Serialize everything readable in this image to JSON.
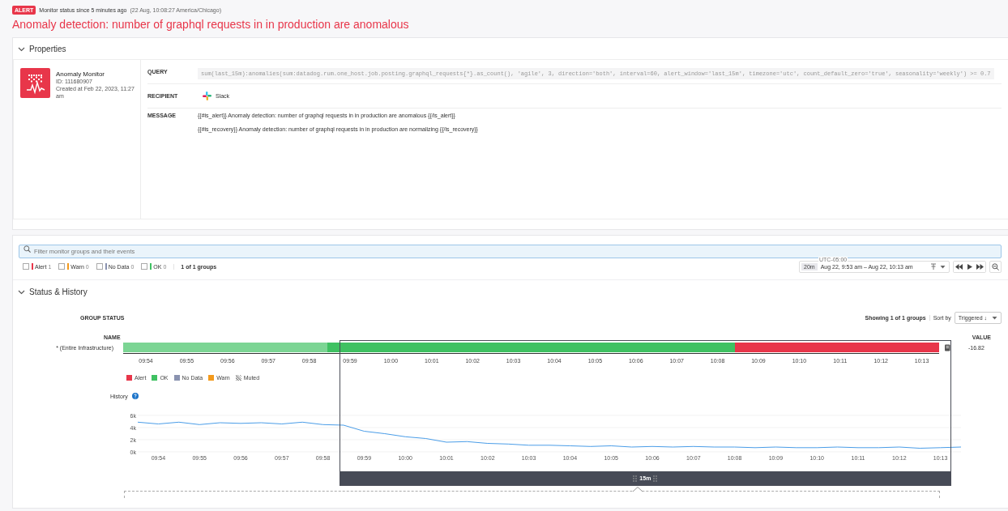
{
  "header": {
    "badge": "ALERT",
    "status_text": "Monitor status since 5 minutes ago",
    "status_time": "(22 Aug, 10:08:27 America/Chicago)",
    "title": "Anomaly detection: number of graphql requests in in production are anomalous"
  },
  "properties": {
    "title": "Properties",
    "expanded": true,
    "monitor": {
      "name": "Anomaly Monitor",
      "id": "ID: 111680907",
      "created": "Created at Feb 22, 2023, 11:27 am"
    },
    "rows": [
      {
        "label": "QUERY",
        "kind": "code",
        "value": "sum(last_15m):anomalies(sum:datadog.rum.one_host.job.posting.graphql_requests{*}.as_count(), 'agile', 3, direction='both', interval=60, alert_window='last_15m', timezone='utc', count_default_zero='true', seasonality='weekly') >= 0.7"
      },
      {
        "label": "RECIPIENT",
        "kind": "recipient",
        "value": "Slack"
      },
      {
        "label": "MESSAGE",
        "kind": "lines",
        "lines": [
          "{{#is_alert}} Anomaly detection: number of graphql requests in in production are anomalous {{/is_alert}}",
          "{{#is_recovery}} Anomaly detection: number of graphql requests in in production are normalizing {{/is_recovery}}"
        ]
      }
    ]
  },
  "filter": {
    "placeholder": "Filter monitor groups and their events",
    "statuses": [
      {
        "label": "Alert",
        "count": "1",
        "color": "#e8364a",
        "checked": false
      },
      {
        "label": "Warn",
        "count": "0",
        "color": "#f39a1c",
        "checked": false
      },
      {
        "label": "No Data",
        "count": "0",
        "color": "#8a93b0",
        "checked": false
      },
      {
        "label": "OK",
        "count": "0",
        "color": "#3fc162",
        "checked": false
      }
    ],
    "groups_count": "1 of 1 groups"
  },
  "time_controls": {
    "span": "20m",
    "timezone": "UTC-05:00",
    "range": "Aug 22, 9:53 am – Aug 22, 10:13 am"
  },
  "status_history": {
    "title": "Status & History",
    "expanded": true,
    "group_status_label": "GROUP STATUS",
    "showing": "Showing 1 of 1 groups",
    "sort_label": "Sort by",
    "sort_value": "Triggered ↓",
    "name_header": "NAME",
    "value_header": "VALUE",
    "groups": [
      {
        "name": "* (Entire Infrastructure)",
        "value": "-16.82",
        "segments": [
          {
            "color": "#3fc162",
            "level": 0.75
          },
          {
            "color": "#e8364a",
            "level": 0.25
          }
        ]
      }
    ],
    "timeline_ticks": [
      "09:54",
      "09:55",
      "09:56",
      "09:57",
      "09:58",
      "09:59",
      "10:00",
      "10:01",
      "10:02",
      "10:03",
      "10:04",
      "10:05",
      "10:06",
      "10:07",
      "10:08",
      "10:09",
      "10:10",
      "10:11",
      "10:12",
      "10:13"
    ],
    "legend": [
      {
        "label": "Alert",
        "kind": "swatch",
        "color": "#e8364a"
      },
      {
        "label": "OK",
        "kind": "swatch",
        "color": "#3fc162"
      },
      {
        "label": "No Data",
        "kind": "swatch",
        "color": "#8a93b0"
      },
      {
        "label": "Warn",
        "kind": "swatch",
        "color": "#f39a1c"
      },
      {
        "label": "Muted",
        "kind": "hatch"
      }
    ],
    "history_label": "History",
    "selection": {
      "label": "15m"
    },
    "chart_data": {
      "type": "line",
      "ylim": [
        0,
        6000
      ],
      "yticks": [
        {
          "value": 0,
          "label": "0k"
        },
        {
          "value": 2000,
          "label": "2k"
        },
        {
          "value": 4000,
          "label": "4k"
        },
        {
          "value": 6000,
          "label": "6k"
        }
      ],
      "categories": [
        null,
        "09:54",
        null,
        "09:55",
        null,
        "09:56",
        null,
        "09:57",
        null,
        "09:58",
        null,
        "09:59",
        null,
        "10:00",
        null,
        "10:01",
        null,
        "10:02",
        null,
        "10:03",
        null,
        "10:04",
        null,
        "10:05",
        null,
        "10:06",
        null,
        "10:07",
        null,
        "10:08",
        null,
        "10:09",
        null,
        "10:10",
        null,
        "10:11",
        null,
        "10:12",
        null,
        "10:13",
        null
      ],
      "series": [
        {
          "color": "#4a9de8",
          "values": [
            4900,
            4600,
            4900,
            4500,
            4800,
            4700,
            4800,
            4600,
            4900,
            4500,
            4400,
            3400,
            3000,
            2500,
            2200,
            1600,
            1700,
            1400,
            1300,
            1100,
            1100,
            1000,
            900,
            1000,
            800,
            900,
            800,
            900,
            800,
            800,
            700,
            800,
            700,
            700,
            800,
            700,
            700,
            800,
            600,
            700,
            800
          ]
        }
      ]
    }
  }
}
